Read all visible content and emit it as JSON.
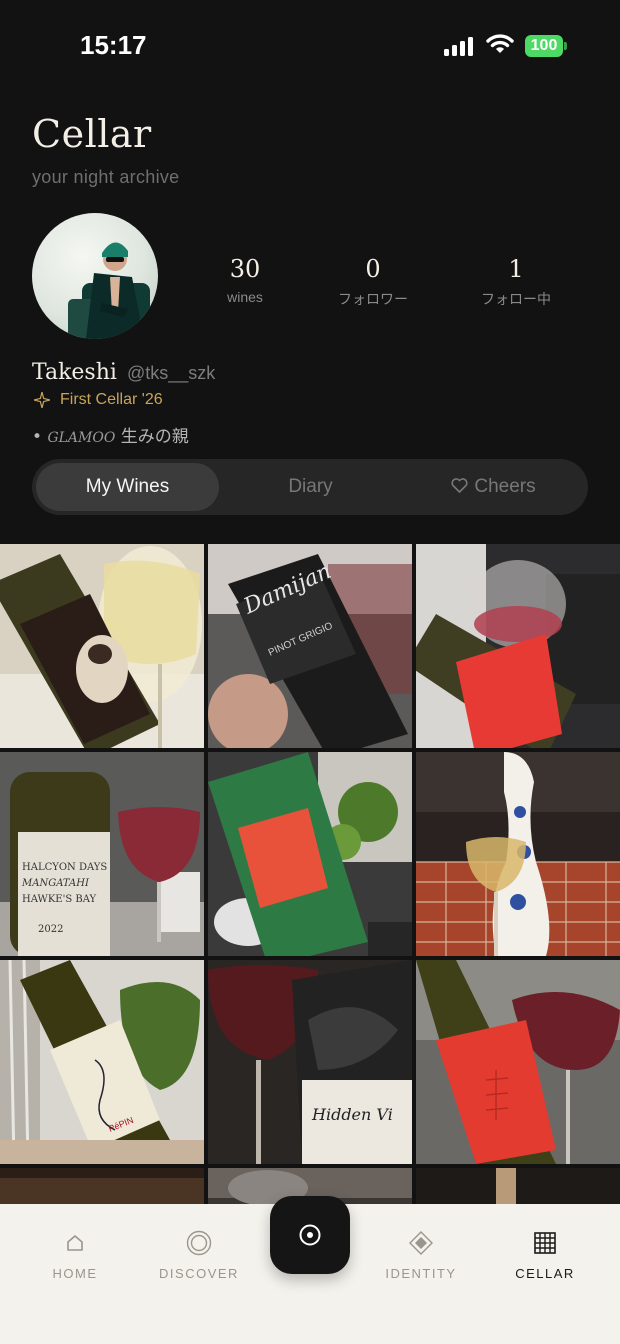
{
  "status_bar": {
    "time": "15:17",
    "battery": "100",
    "icons": [
      "signal-icon",
      "wifi-icon",
      "battery-icon"
    ]
  },
  "header": {
    "title": "Cellar",
    "subtitle": "your night archive"
  },
  "profile": {
    "name": "Takeshi",
    "handle": "@tks__szk",
    "badge": "First Cellar '26",
    "bio_bullet": "•",
    "bio_brand": "GLAMOO",
    "bio_text": "生みの親"
  },
  "stats": [
    {
      "value": "30",
      "label": "wines"
    },
    {
      "value": "0",
      "label": "フォロワー"
    },
    {
      "value": "1",
      "label": "フォロー中"
    }
  ],
  "tabs": {
    "my_wines": "My Wines",
    "diary": "Diary",
    "cheers": "Cheers",
    "active": "My Wines"
  },
  "bottle_labels": {
    "damijan": "Damijan",
    "pinot_grigio": "PINOT GRIGIO",
    "halcyon_1": "HALCYON DAYS",
    "halcyon_2": "MANGATAHI",
    "halcyon_3": "HAWKE'S BAY",
    "halcyon_year": "2022",
    "pepin": "PéPIN",
    "hidden": "Hidden Vi"
  },
  "nav": {
    "home": "HOME",
    "discover": "DISCOVER",
    "identity": "IDENTITY",
    "cellar": "CELLAR",
    "active": "CELLAR"
  },
  "colors": {
    "background": "#121212",
    "accent_gold": "#c8a45c",
    "nav_background": "#f4f2ec",
    "battery_green": "#4cd964"
  }
}
